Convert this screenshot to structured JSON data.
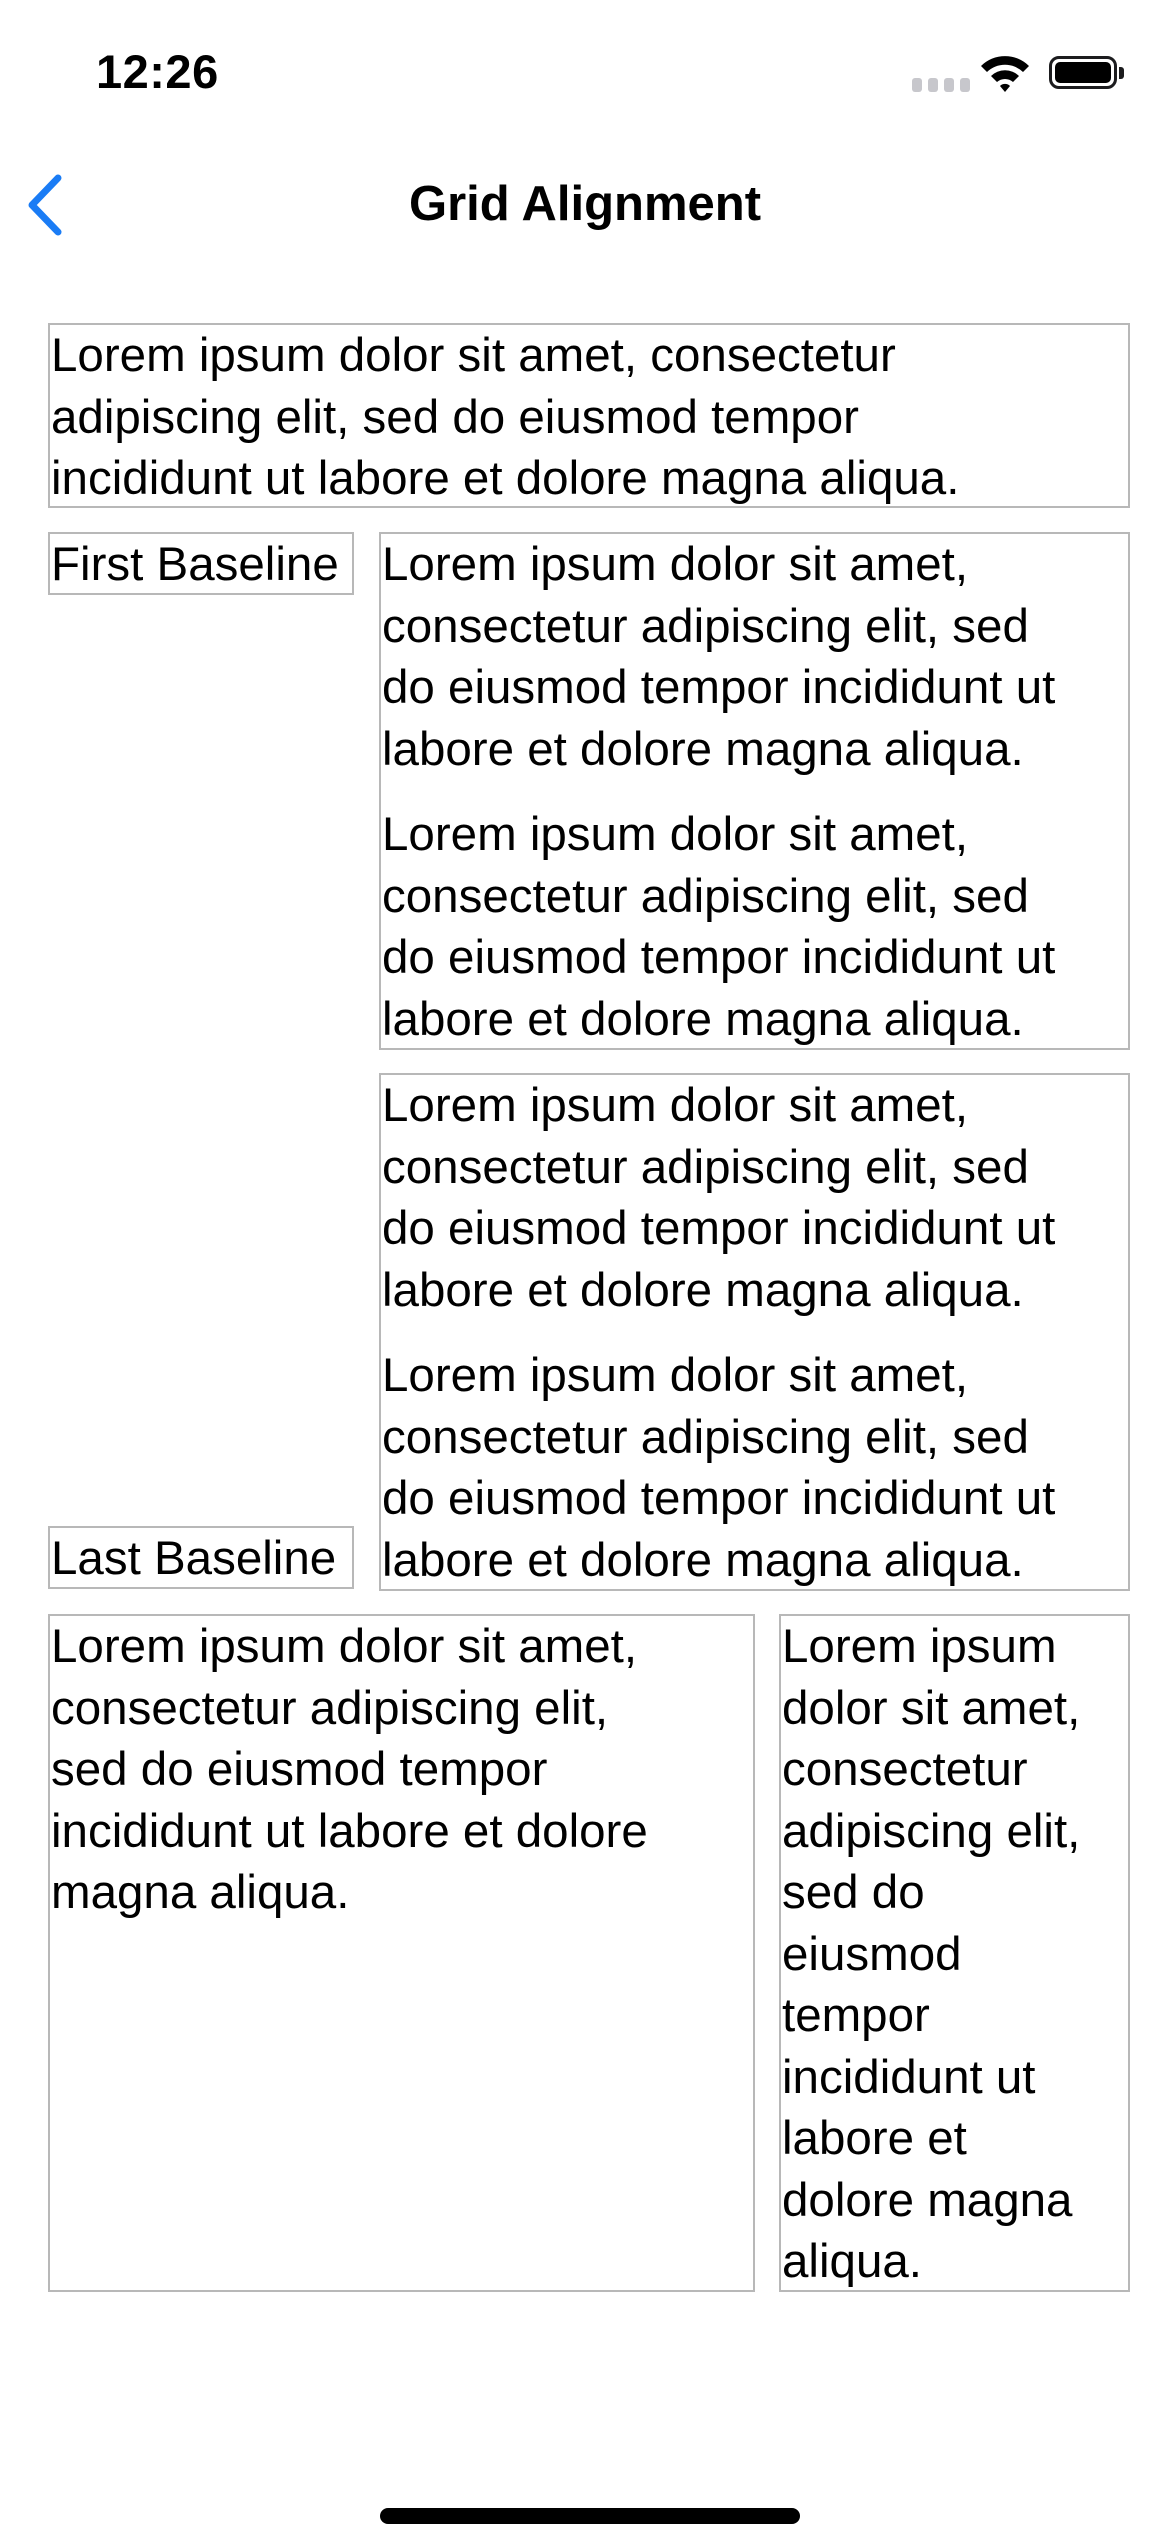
{
  "status_bar": {
    "time": "12:26",
    "signal_icon": "cellular-signal-icon",
    "wifi_icon": "wifi-icon",
    "battery_icon": "battery-icon"
  },
  "nav": {
    "back_icon": "chevron-left-icon",
    "title": "Grid Alignment",
    "accent_color": "#1a7cf5"
  },
  "grid": {
    "row1": {
      "lines": [
        "Lorem ipsum dolor sit amet, consectetur",
        "adipiscing elit, sed do eiusmod tempor",
        "incididunt ut labore et dolore magna aliqua."
      ]
    },
    "row2": {
      "label": "First Baseline",
      "paragraphs": [
        [
          "Lorem ipsum dolor sit amet,",
          "consectetur adipiscing elit, sed",
          "do eiusmod tempor incididunt ut",
          "labore et dolore magna aliqua."
        ],
        [
          "Lorem ipsum dolor sit amet,",
          "consectetur adipiscing elit, sed",
          "do eiusmod tempor incididunt ut",
          "labore et dolore magna aliqua."
        ]
      ]
    },
    "row3": {
      "label": "Last Baseline",
      "paragraphs": [
        [
          "Lorem ipsum dolor sit amet,",
          "consectetur adipiscing elit, sed",
          "do eiusmod tempor incididunt ut",
          "labore et dolore magna aliqua."
        ],
        [
          "Lorem ipsum dolor sit amet,",
          "consectetur adipiscing elit, sed",
          "do eiusmod tempor incididunt ut",
          "labore et dolore magna aliqua."
        ]
      ]
    },
    "row4": {
      "left_lines": [
        "Lorem ipsum dolor sit amet,",
        "consectetur adipiscing elit,",
        "sed do eiusmod tempor",
        "incididunt ut labore et dolore",
        "magna aliqua."
      ],
      "right_lines": [
        "Lorem ipsum",
        "dolor sit amet,",
        "consectetur",
        "adipiscing elit,",
        "sed do",
        "eiusmod",
        "tempor",
        "incididunt ut",
        "labore et",
        "dolore magna",
        "aliqua."
      ]
    }
  }
}
